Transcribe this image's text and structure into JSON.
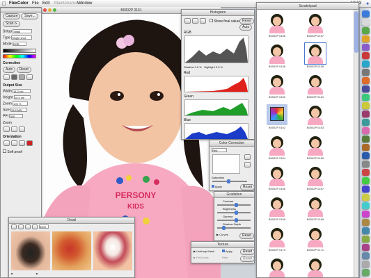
{
  "menubar": {
    "app": "FlexColor",
    "items": [
      "File",
      "Edit",
      "Maintenance",
      "Window"
    ],
    "time": "18:13"
  },
  "tools": {
    "capture": "Capture",
    "save": "Save...",
    "scan": "Scan ⊳",
    "setup_label": "Setup",
    "setup_val": "Initial",
    "type_label": "Type",
    "type_val": "Single shot",
    "mode_label": "Mode",
    "mode_val": "RGB",
    "correction_label": "Correction",
    "auto": "Auto",
    "reset": "Reset",
    "output_label": "Output Size",
    "width_label": "Width",
    "width_val": "14.2 cm",
    "height_label": "Height",
    "height_val": "10.4 cm",
    "zoom_label": "Zoom",
    "zoom_val": "100 %",
    "size_label": "Size",
    "size_val": "28.2 MB",
    "ppi_label": "PPI",
    "ppi_val": "300",
    "zoom2_label": "Zoom",
    "orientation_label": "Orientation",
    "soft_proof": "Soft proof"
  },
  "image_window": {
    "title": "B0002P 0161"
  },
  "histogram": {
    "title": "Histogram",
    "show_final": "Show final values",
    "reset": "Reset",
    "auto": "Auto",
    "channels": [
      "RGB",
      "Red",
      "Green",
      "Blue"
    ],
    "shadow_label": "Shadow",
    "shadow_val": "0.5 %",
    "highlight_label": "Highlight",
    "highlight_val": "0.0 %",
    "ticks": [
      "0",
      "50",
      "100",
      "150",
      "200",
      "255"
    ]
  },
  "color_correction": {
    "title": "Color Correction",
    "channel": "Red",
    "saturation_label": "Saturation",
    "apply": "Apply",
    "reset": "Reset"
  },
  "gradation": {
    "title": "Gradation",
    "contrast": "Contrast",
    "brightness": "Brightness",
    "gamma": "Gamma",
    "shadow_depth": "Shadow Depth",
    "curves": "Curves",
    "reset": "Reset"
  },
  "texture": {
    "title": "Texture",
    "unsharp": "Unsharp Mask",
    "apply": "Apply",
    "reset": "Reset",
    "pre_check": "PreCheck",
    "filter": "Filter"
  },
  "detail": {
    "title": "Detail",
    "count": "3009"
  },
  "scratchpad": {
    "title": "Scratchpad",
    "captions": [
      "B0002P 0156",
      "B0002P 0157",
      "B0002P 0158",
      "B0002P 0159",
      "B0002P 0160",
      "B0002P 0161",
      "B0002P 0162",
      "B0002P 0163",
      "B0002P 0164",
      "B0002P 0165",
      "B0002P 0166",
      "B0002P 0167",
      "B0002P 0168",
      "B0002P 0169",
      "B0002P 0170",
      "B0002P 0171",
      "B0002P 0172",
      "B0002P 0173"
    ]
  },
  "colors": {
    "accent": "#4a7bd0",
    "red": "#e0201a",
    "green": "#1f9e2a",
    "blue": "#1a3cc9",
    "skin": "#f3c6a8",
    "pink": "#f7a9c2"
  }
}
